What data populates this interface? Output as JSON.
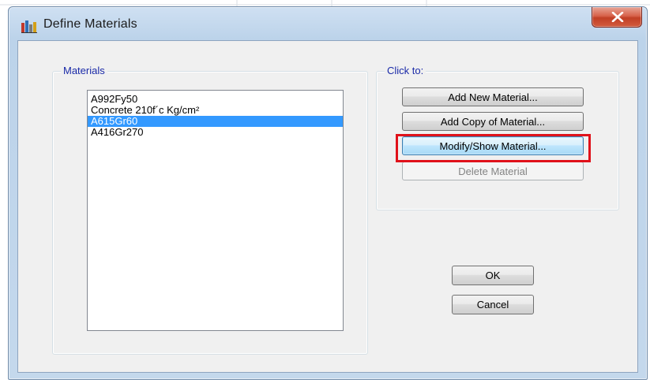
{
  "window": {
    "title": "Define Materials",
    "icon": "structure-app-icon",
    "close_icon": "close-icon"
  },
  "materials_group": {
    "label": "Materials",
    "items": [
      {
        "label": "A992Fy50",
        "selected": false
      },
      {
        "label": "Concrete 210f´c Kg/cm²",
        "selected": false
      },
      {
        "label": "A615Gr60",
        "selected": true
      },
      {
        "label": "A416Gr270",
        "selected": false
      }
    ]
  },
  "actions_group": {
    "label": "Click to:",
    "add_new": "Add New Material...",
    "add_copy": "Add Copy of Material...",
    "modify_show": "Modify/Show Material...",
    "delete": "Delete Material"
  },
  "dialog_buttons": {
    "ok": "OK",
    "cancel": "Cancel"
  },
  "colors": {
    "selection": "#3399ff",
    "group_label": "#1a2aa8",
    "highlight": "#e0111a"
  }
}
